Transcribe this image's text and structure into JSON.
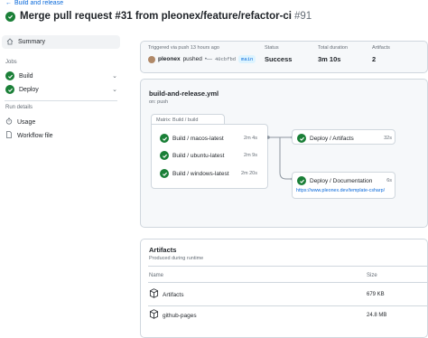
{
  "header": {
    "back_label": "Build and release",
    "title": "Merge pull request #31 from pleonex/feature/refactor-ci",
    "run_number": "#91"
  },
  "sidebar": {
    "summary_label": "Summary",
    "jobs_heading": "Jobs",
    "jobs": [
      {
        "label": "Build"
      },
      {
        "label": "Deploy"
      }
    ],
    "run_details_heading": "Run details",
    "details": [
      {
        "label": "Usage"
      },
      {
        "label": "Workflow file"
      }
    ]
  },
  "summary": {
    "trigger": "Triggered via push 13 hours ago",
    "actor": "pleonex",
    "action": "pushed",
    "commit": "40cbfbd",
    "branch": "main",
    "status_label": "Status",
    "status_value": "Success",
    "duration_label": "Total duration",
    "duration_value": "3m 10s",
    "artifacts_label": "Artifacts",
    "artifacts_value": "2"
  },
  "workflow": {
    "file": "build-and-release.yml",
    "trigger": "on: push",
    "matrix_title": "Matrix: Build / build",
    "matrix_jobs": [
      {
        "name": "Build / macos-latest",
        "duration": "2m 4s"
      },
      {
        "name": "Build / ubuntu-latest",
        "duration": "2m 9s"
      },
      {
        "name": "Build / windows-latest",
        "duration": "2m 20s"
      }
    ],
    "deploy_artifacts": {
      "name": "Deploy / Artifacts",
      "duration": "32s"
    },
    "deploy_docs": {
      "name": "Deploy / Documentation",
      "duration": "6s",
      "url": "https://www.pleonex.dev/template-csharp/"
    }
  },
  "artifacts": {
    "title": "Artifacts",
    "subtitle": "Produced during runtime",
    "col_name": "Name",
    "col_size": "Size",
    "rows": [
      {
        "name": "Artifacts",
        "size": "679 KB"
      },
      {
        "name": "github-pages",
        "size": "24.8 MB"
      }
    ]
  },
  "colors": {
    "success": "#1a7f37",
    "link": "#0969da",
    "border": "#d0d7de"
  },
  "icons": [
    "arrow-left-icon",
    "check-circle-icon",
    "home-icon",
    "chevron-down-icon",
    "stopwatch-icon",
    "file-icon",
    "package-icon"
  ]
}
